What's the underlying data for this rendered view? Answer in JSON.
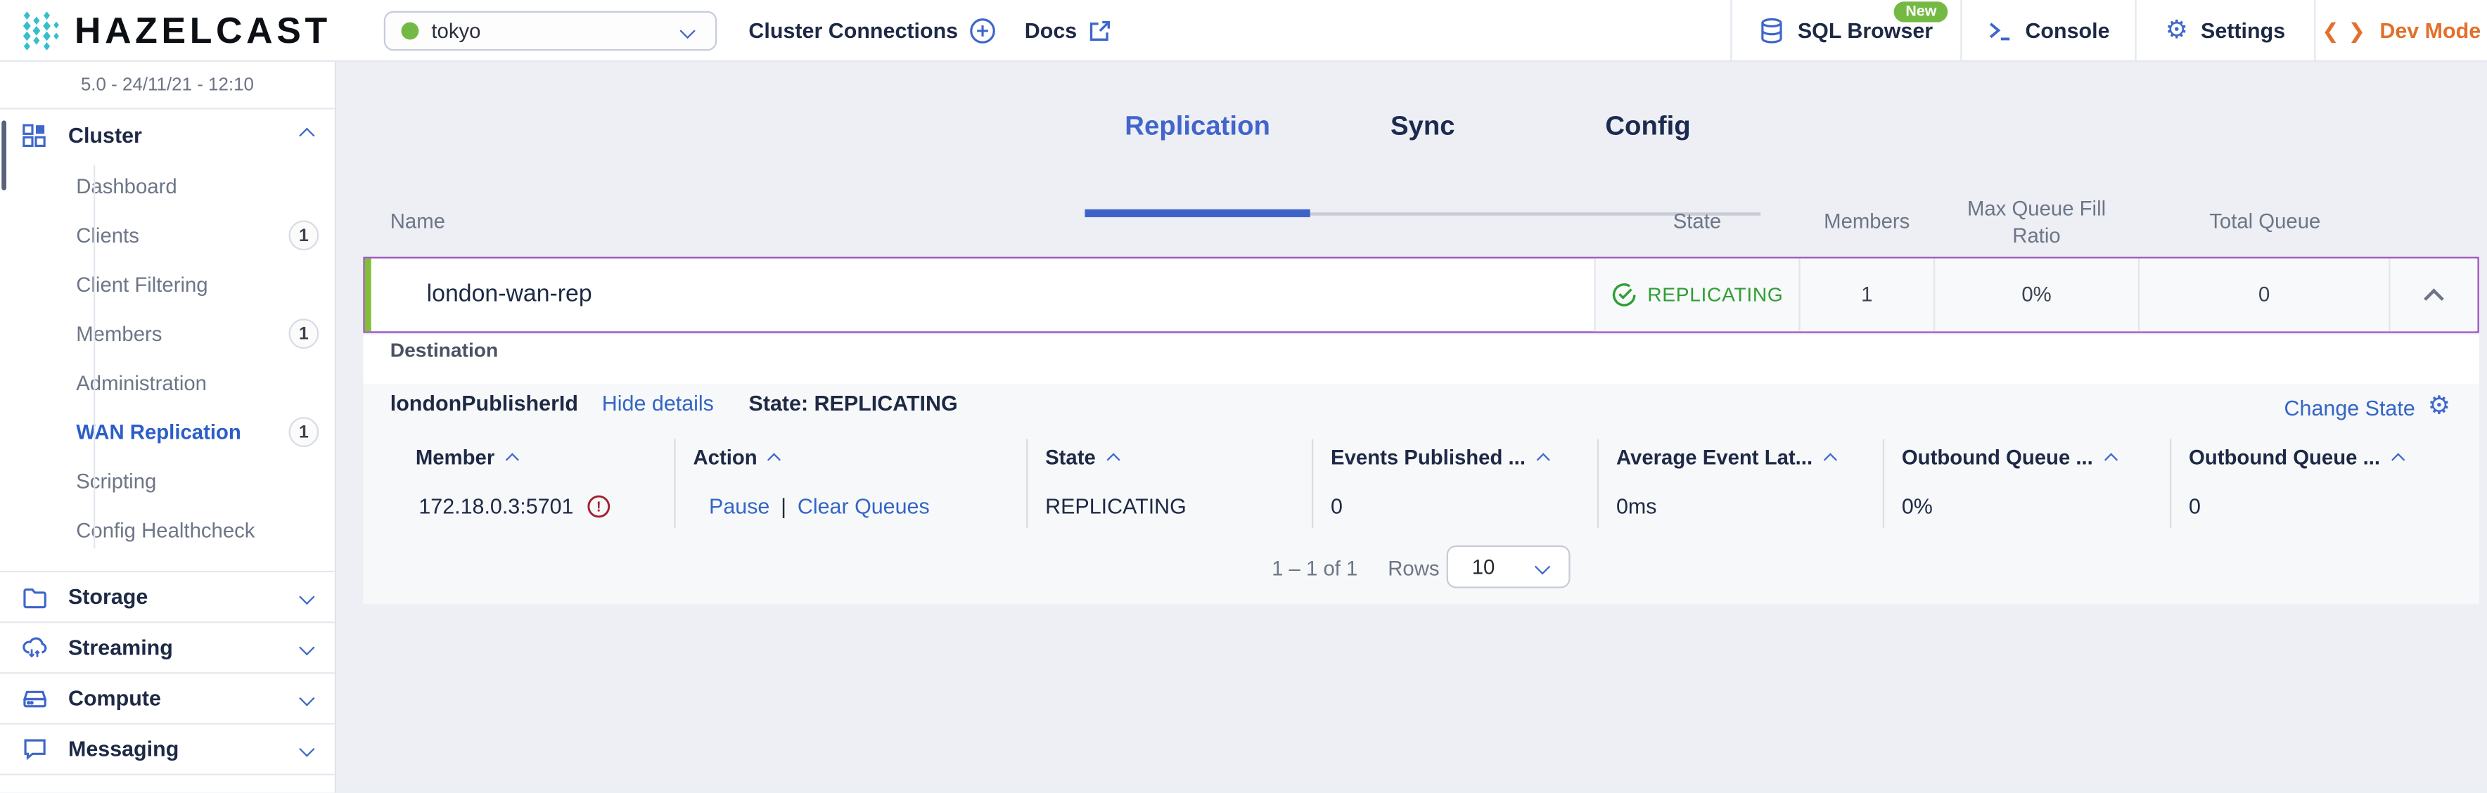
{
  "header": {
    "logo_text": "HAZELCAST",
    "cluster_select": {
      "value": "tokyo"
    },
    "cluster_connections_label": "Cluster Connections",
    "docs_label": "Docs",
    "sql_browser_label": "SQL Browser",
    "sql_browser_badge": "New",
    "console_label": "Console",
    "settings_label": "Settings",
    "dev_mode_label": "Dev Mode"
  },
  "sidebar": {
    "version": "5.0 - 24/11/21 - 12:10",
    "cluster_section": {
      "label": "Cluster",
      "items": [
        {
          "label": "Dashboard"
        },
        {
          "label": "Clients",
          "badge": "1"
        },
        {
          "label": "Client Filtering"
        },
        {
          "label": "Members",
          "badge": "1"
        },
        {
          "label": "Administration"
        },
        {
          "label": "WAN Replication",
          "badge": "1",
          "active": true
        },
        {
          "label": "Scripting"
        },
        {
          "label": "Config Healthcheck"
        }
      ]
    },
    "sections": [
      {
        "label": "Storage"
      },
      {
        "label": "Streaming"
      },
      {
        "label": "Compute"
      },
      {
        "label": "Messaging"
      }
    ]
  },
  "tabs": {
    "replication": "Replication",
    "sync": "Sync",
    "config": "Config"
  },
  "table": {
    "headers": {
      "name": "Name",
      "state": "State",
      "members": "Members",
      "max_queue_fill_ratio": "Max Queue Fill Ratio",
      "total_queue": "Total Queue"
    },
    "row": {
      "name": "london-wan-rep",
      "state": "REPLICATING",
      "members": "1",
      "max_queue_fill_ratio": "0%",
      "total_queue": "0"
    }
  },
  "detail": {
    "section_label": "Destination",
    "publisher_id": "londonPublisherId",
    "hide_details_label": "Hide details",
    "state_text": "State: REPLICATING",
    "change_state_label": "Change State",
    "columns": {
      "member": "Member",
      "action": "Action",
      "state": "State",
      "events_published": "Events Published ...",
      "avg_event_latency": "Average Event Lat...",
      "outbound_queue_pct": "Outbound Queue ...",
      "outbound_queue": "Outbound Queue ..."
    },
    "row": {
      "member": "172.18.0.3:5701",
      "pause": "Pause",
      "clear_queues": "Clear Queues",
      "state": "REPLICATING",
      "events_published": "0",
      "avg_event_latency": "0ms",
      "outbound_queue_pct": "0%",
      "outbound_queue": "0"
    },
    "pagination": {
      "range": "1 – 1 of 1",
      "rows_label": "Rows",
      "rows_value": "10"
    }
  },
  "colors": {
    "accent_blue": "#3e66cb",
    "navy": "#1d2945",
    "state_green": "#2f9e33",
    "accent_lime": "#84bd3a",
    "dev_mode_orange": "#e2702c",
    "selection_purple": "#9a4fbd",
    "warning_red": "#a32231"
  }
}
